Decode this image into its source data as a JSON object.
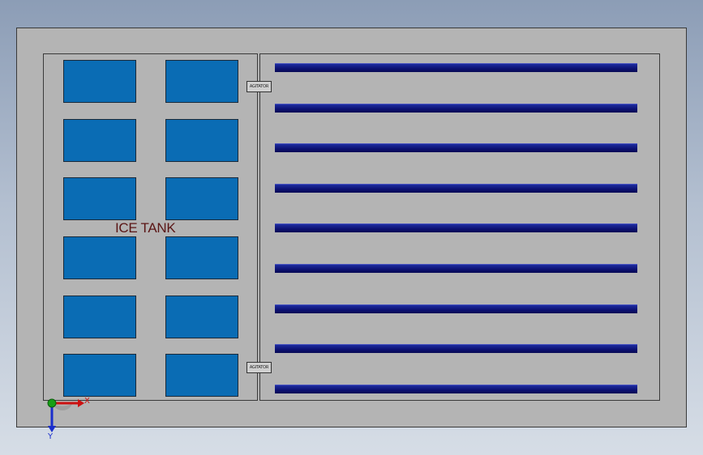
{
  "drawing": {
    "tank_label": "ICE TANK",
    "agitator_labels": [
      "AGITATOR",
      "AGITATOR"
    ]
  },
  "triad": {
    "x_label": "X",
    "y_label": "Y"
  },
  "colors": {
    "background_top": "#8c9db6",
    "plate": "#b4b4b4",
    "ice_block": "#0a6cb4",
    "rack_bar": "#0b1070",
    "label": "#5a1515",
    "axis_x": "#cc1111",
    "axis_y": "#1a2ecc",
    "origin": "#16a016"
  },
  "counts": {
    "ice_blocks": 12,
    "rack_bars": 9
  }
}
